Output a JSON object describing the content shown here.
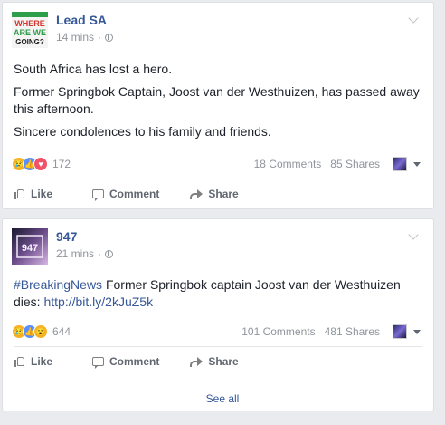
{
  "colors": {
    "link": "#365899",
    "meta": "#90949c",
    "background": "#e9ebee"
  },
  "posts": [
    {
      "page_name": "Lead SA",
      "avatar_text": "WHERE ARE WE GOING?",
      "time": "14 mins",
      "separator": "·",
      "paragraphs": [
        "South Africa has lost a hero.",
        "Former Springbok Captain, Joost van der Westhuizen, has passed away this afternoon.",
        "Sincere condolences to his family and friends."
      ],
      "reaction_count": "172",
      "comments": "18 Comments",
      "shares": "85 Shares",
      "actions": {
        "like": "Like",
        "comment": "Comment",
        "share": "Share"
      }
    },
    {
      "page_name": "947",
      "avatar_text": "947",
      "time": "21 mins",
      "separator": "·",
      "hashtag": "#BreakingNews",
      "text_before_link": " Former Springbok captain Joost van der Westhuizen dies: ",
      "link": "http://bit.ly/2kJuZ5k",
      "reaction_count": "644",
      "comments": "101 Comments",
      "shares": "481 Shares",
      "actions": {
        "like": "Like",
        "comment": "Comment",
        "share": "Share"
      }
    }
  ],
  "footer": {
    "see_all": "See all"
  }
}
